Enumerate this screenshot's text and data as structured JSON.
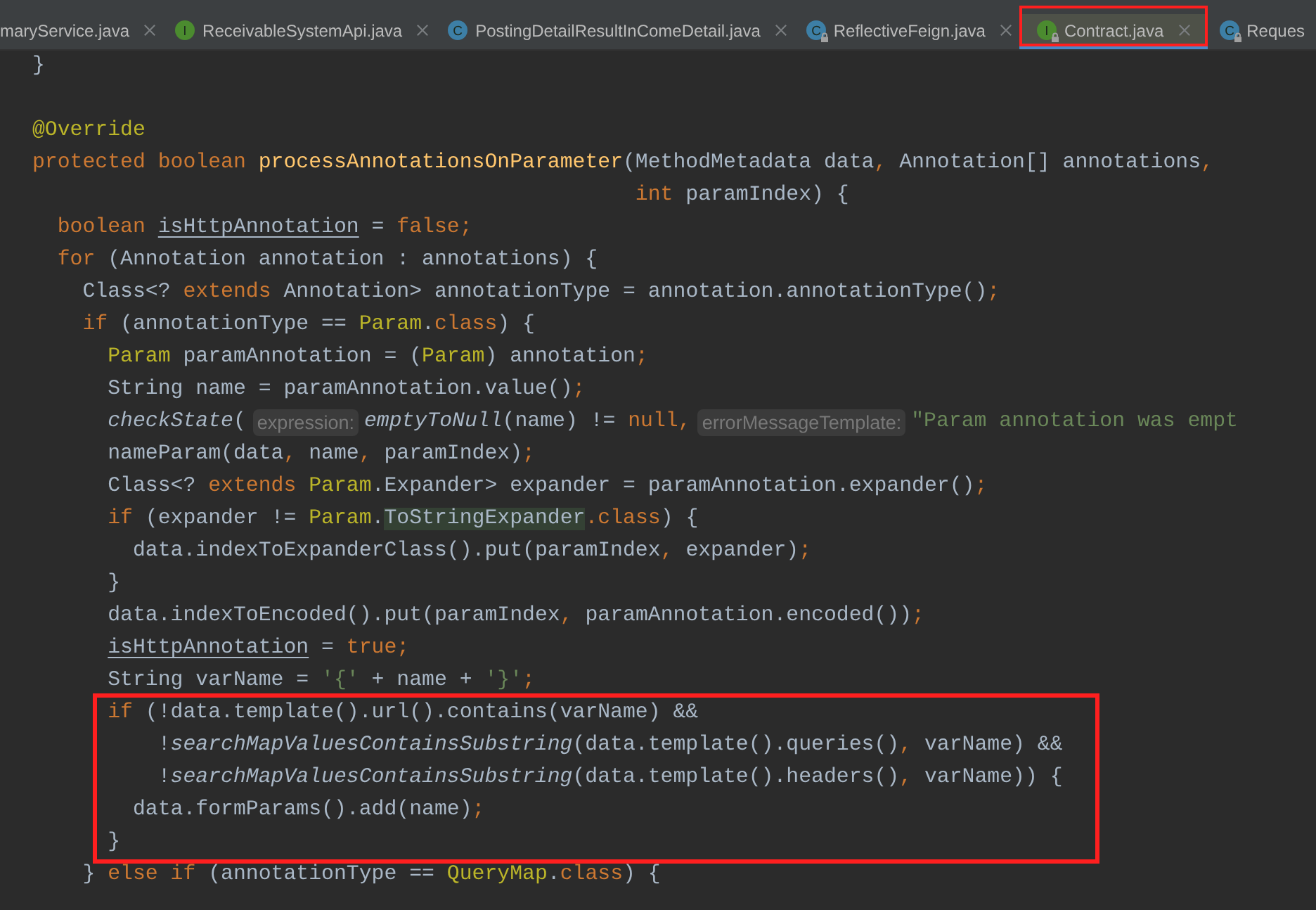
{
  "tabs": [
    {
      "label": "maryService.java",
      "selected": false,
      "marked": false,
      "locked": false,
      "closable": true
    },
    {
      "label": "ReceivableSystemApi.java",
      "kind": "interface",
      "icon_letter": "I",
      "selected": false,
      "marked": false,
      "locked": false,
      "closable": true
    },
    {
      "label": "PostingDetailResultInComeDetail.java",
      "kind": "class",
      "icon_letter": "C",
      "selected": false,
      "marked": false,
      "locked": false,
      "closable": true
    },
    {
      "label": "ReflectiveFeign.java",
      "kind": "class",
      "icon_letter": "C",
      "selected": false,
      "marked": false,
      "locked": true,
      "closable": true
    },
    {
      "label": "Contract.java",
      "kind": "interface",
      "icon_letter": "I",
      "selected": true,
      "marked": true,
      "locked": true,
      "closable": true
    },
    {
      "label": "Reques",
      "kind": "class",
      "icon_letter": "C",
      "selected": false,
      "marked": false,
      "locked": true,
      "closable": false
    }
  ],
  "code_lines": [
    {
      "tokens": [
        {
          "kind": "plain",
          "text": "}"
        }
      ]
    },
    {
      "kind": "blank"
    },
    {
      "tokens": [
        {
          "kind": "annotation",
          "text": "@Override"
        }
      ]
    },
    {
      "tokens": [
        {
          "kind": "keyword",
          "text": "protected boolean "
        },
        {
          "kind": "method",
          "text": "processAnnotationsOnParameter"
        },
        {
          "kind": "plain",
          "text": "(MethodMetadata data"
        },
        {
          "kind": "keyword",
          "text": ", "
        },
        {
          "kind": "plain",
          "text": "Annotation[] annotations"
        },
        {
          "kind": "keyword",
          "text": ","
        }
      ]
    },
    {
      "tokens": [
        {
          "kind": "keyword",
          "text": "                                                int"
        },
        {
          "kind": "plain",
          "text": " paramIndex) {"
        }
      ]
    },
    {
      "tokens": [
        {
          "kind": "keyword",
          "text": "  boolean "
        },
        {
          "kind": "mutable",
          "text": "isHttpAnnotation"
        },
        {
          "kind": "plain",
          "text": " = "
        },
        {
          "kind": "keyword",
          "text": "false;"
        }
      ]
    },
    {
      "tokens": [
        {
          "kind": "keyword",
          "text": "  for"
        },
        {
          "kind": "plain",
          "text": " (Annotation annotation : annotations) {"
        }
      ]
    },
    {
      "tokens": [
        {
          "kind": "plain",
          "text": "    Class<? "
        },
        {
          "kind": "keyword",
          "text": "extends"
        },
        {
          "kind": "plain",
          "text": " Annotation> annotationType = annotation.annotationType()"
        },
        {
          "kind": "keyword",
          "text": ";"
        }
      ]
    },
    {
      "tokens": [
        {
          "kind": "keyword",
          "text": "    if"
        },
        {
          "kind": "plain",
          "text": " (annotationType == "
        },
        {
          "kind": "type",
          "text": "Param"
        },
        {
          "kind": "plain",
          "text": "."
        },
        {
          "kind": "keyword",
          "text": "class"
        },
        {
          "kind": "plain",
          "text": ") {"
        }
      ]
    },
    {
      "tokens": [
        {
          "kind": "type",
          "text": "      Param"
        },
        {
          "kind": "plain",
          "text": " paramAnnotation = ("
        },
        {
          "kind": "type",
          "text": "Param"
        },
        {
          "kind": "plain",
          "text": ") annotation"
        },
        {
          "kind": "keyword",
          "text": ";"
        }
      ]
    },
    {
      "tokens": [
        {
          "kind": "plain",
          "text": "      String name = paramAnnotation.value()"
        },
        {
          "kind": "keyword",
          "text": ";"
        }
      ]
    },
    {
      "tokens": [
        {
          "kind": "static",
          "text": "      checkState"
        },
        {
          "kind": "plain",
          "text": "("
        },
        {
          "kind": "hint",
          "text": "expression:"
        },
        {
          "kind": "static",
          "text": "emptyToNull"
        },
        {
          "kind": "plain",
          "text": "(name) != "
        },
        {
          "kind": "keyword",
          "text": "null,"
        },
        {
          "kind": "hint",
          "text": "errorMessageTemplate:"
        },
        {
          "kind": "string",
          "text": "\"Param annotation was empt"
        }
      ]
    },
    {
      "tokens": [
        {
          "kind": "plain",
          "text": "      nameParam(data"
        },
        {
          "kind": "keyword",
          "text": ", "
        },
        {
          "kind": "plain",
          "text": "name"
        },
        {
          "kind": "keyword",
          "text": ", "
        },
        {
          "kind": "plain",
          "text": "paramIndex)"
        },
        {
          "kind": "keyword",
          "text": ";"
        }
      ]
    },
    {
      "tokens": [
        {
          "kind": "plain",
          "text": "      Class<? "
        },
        {
          "kind": "keyword",
          "text": "extends "
        },
        {
          "kind": "type",
          "text": "Param"
        },
        {
          "kind": "plain",
          "text": ".Expander> expander = paramAnnotation.expander()"
        },
        {
          "kind": "keyword",
          "text": ";"
        }
      ]
    },
    {
      "tokens": [
        {
          "kind": "keyword",
          "text": "      if"
        },
        {
          "kind": "plain",
          "text": " (expander != "
        },
        {
          "kind": "type",
          "text": "Param"
        },
        {
          "kind": "plain",
          "text": "."
        },
        {
          "kind": "match",
          "text": "ToStringExpander"
        },
        {
          "kind": "keyword",
          "text": ".class"
        },
        {
          "kind": "plain",
          "text": ") {"
        }
      ]
    },
    {
      "tokens": [
        {
          "kind": "plain",
          "text": "        data.indexToExpanderClass().put(paramIndex"
        },
        {
          "kind": "keyword",
          "text": ", "
        },
        {
          "kind": "plain",
          "text": "expander)"
        },
        {
          "kind": "keyword",
          "text": ";"
        }
      ]
    },
    {
      "tokens": [
        {
          "kind": "plain",
          "text": "      }"
        }
      ]
    },
    {
      "tokens": [
        {
          "kind": "plain",
          "text": "      data.indexToEncoded().put(paramIndex"
        },
        {
          "kind": "keyword",
          "text": ", "
        },
        {
          "kind": "plain",
          "text": "paramAnnotation.encoded())"
        },
        {
          "kind": "keyword",
          "text": ";"
        }
      ]
    },
    {
      "tokens": [
        {
          "kind": "mutable",
          "text": "      isHttpAnnotation"
        },
        {
          "kind": "plain",
          "text": " = "
        },
        {
          "kind": "keyword",
          "text": "true;"
        }
      ]
    },
    {
      "tokens": [
        {
          "kind": "plain",
          "text": "      String varName = "
        },
        {
          "kind": "string",
          "text": "'{'"
        },
        {
          "kind": "plain",
          "text": " + name + "
        },
        {
          "kind": "string",
          "text": "'}'"
        },
        {
          "kind": "keyword",
          "text": ";"
        }
      ]
    },
    {
      "kind": "highlight_box",
      "lines": [
        {
          "tokens": [
            {
              "kind": "keyword",
              "text": "      if"
            },
            {
              "kind": "plain",
              "text": " (!data.template().url().contains(varName) &&"
            }
          ]
        },
        {
          "tokens": [
            {
              "kind": "plain",
              "text": "          !"
            },
            {
              "kind": "static",
              "text": "searchMapValuesContainsSubstring"
            },
            {
              "kind": "plain",
              "text": "(data.template().queries()"
            },
            {
              "kind": "keyword",
              "text": ", "
            },
            {
              "kind": "plain",
              "text": "varName) &&"
            }
          ]
        },
        {
          "tokens": [
            {
              "kind": "plain",
              "text": "          !"
            },
            {
              "kind": "static",
              "text": "searchMapValuesContainsSubstring"
            },
            {
              "kind": "plain",
              "text": "(data.template().headers()"
            },
            {
              "kind": "keyword",
              "text": ", "
            },
            {
              "kind": "plain",
              "text": "varName)) {"
            }
          ]
        },
        {
          "tokens": [
            {
              "kind": "plain",
              "text": "        data.formParams().add(name)"
            },
            {
              "kind": "keyword",
              "text": ";"
            }
          ]
        },
        {
          "tokens": [
            {
              "kind": "plain",
              "text": "      }"
            }
          ]
        }
      ]
    },
    {
      "tokens": [
        {
          "kind": "plain",
          "text": "    } "
        },
        {
          "kind": "keyword",
          "text": "else if"
        },
        {
          "kind": "plain",
          "text": " (annotationType == "
        },
        {
          "kind": "type",
          "text": "QueryMap"
        },
        {
          "kind": "plain",
          "text": "."
        },
        {
          "kind": "keyword",
          "text": "class"
        },
        {
          "kind": "plain",
          "text": ") {"
        }
      ]
    }
  ]
}
